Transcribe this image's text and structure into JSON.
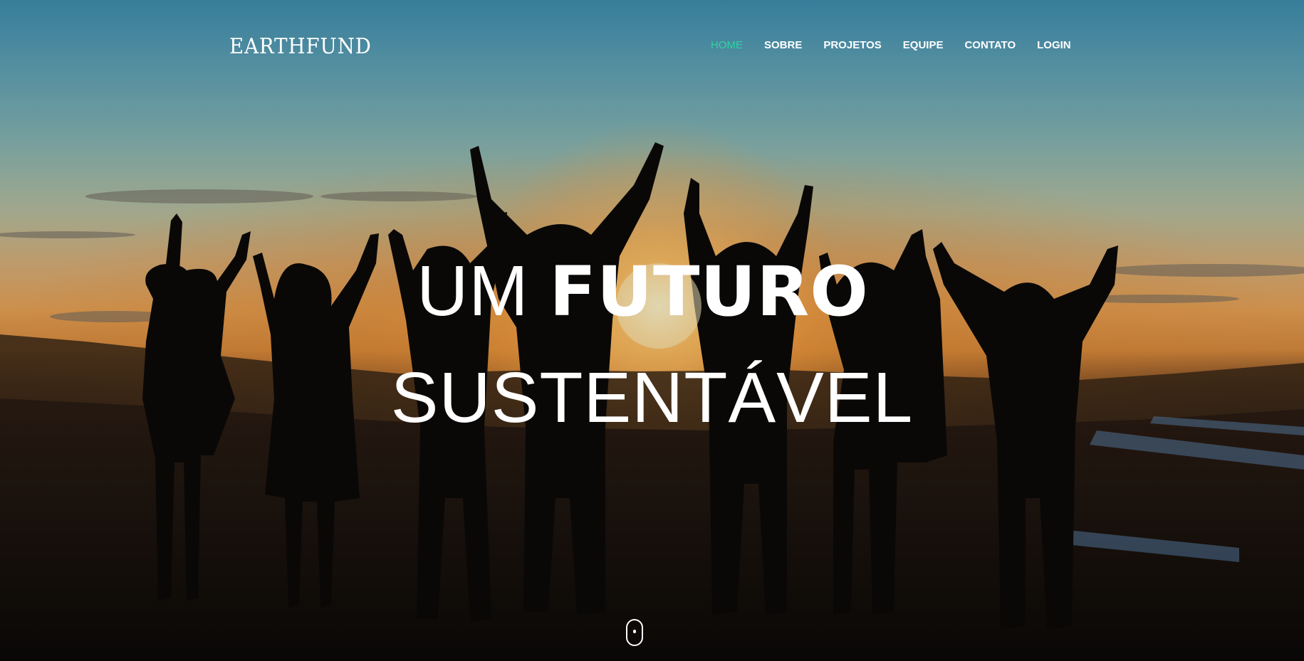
{
  "brand": {
    "logo_text": "EARTHFUND"
  },
  "nav": {
    "items": [
      {
        "label": "HOME",
        "active": true
      },
      {
        "label": "SOBRE",
        "active": false
      },
      {
        "label": "PROJETOS",
        "active": false
      },
      {
        "label": "EQUIPE",
        "active": false
      },
      {
        "label": "CONTATO",
        "active": false
      },
      {
        "label": "LOGIN",
        "active": false
      }
    ],
    "active_color": "#2fd3a4"
  },
  "hero": {
    "headline_light": "UM ",
    "headline_bold": "FUTURO",
    "headline_line2": "SUSTENTÁVEL"
  },
  "scroll_indicator": {
    "icon": "mouse-scroll-icon"
  }
}
